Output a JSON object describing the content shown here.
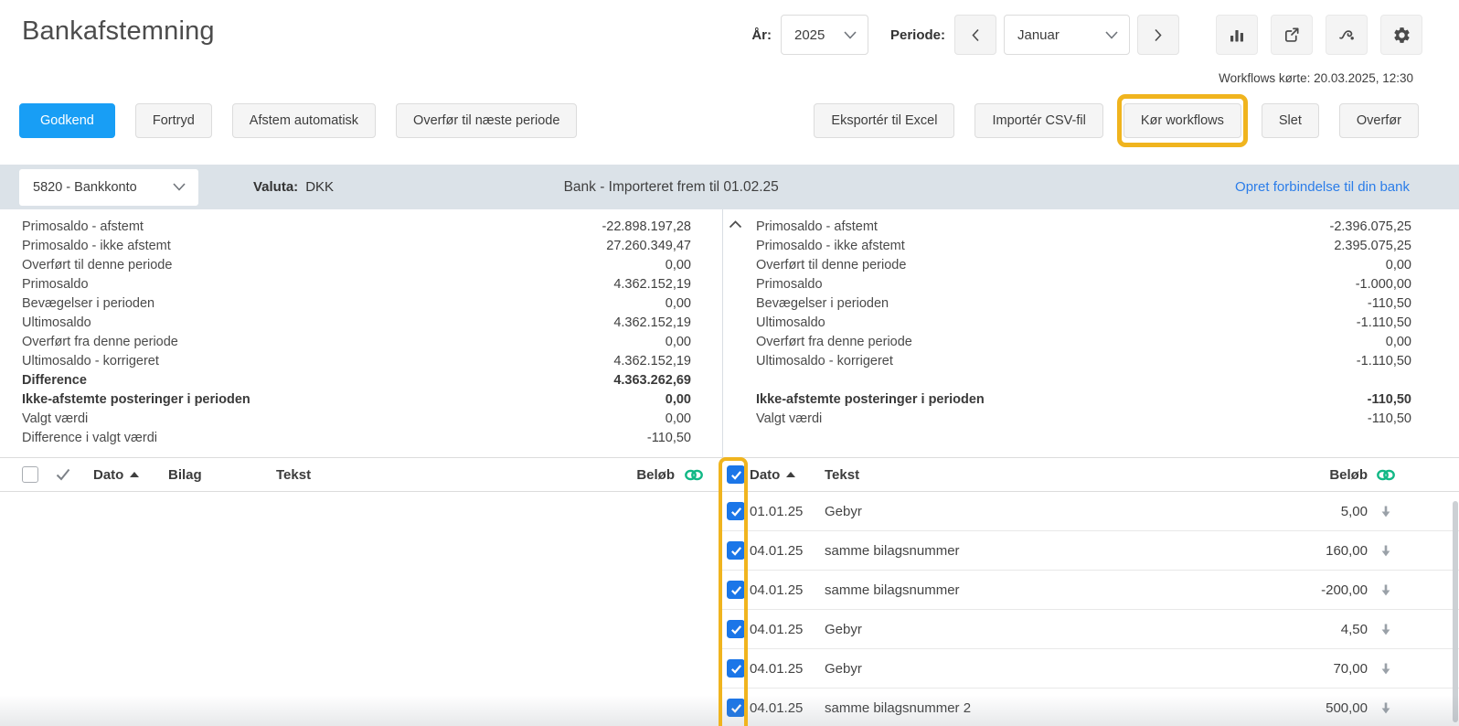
{
  "app": {
    "title": "Bankafstemning"
  },
  "period_bar": {
    "year_label": "År:",
    "year_value": "2025",
    "period_label": "Periode:",
    "period_value": "Januar",
    "icons": [
      "bar-chart",
      "open-external",
      "workflow",
      "settings"
    ],
    "workflows_last_run": "Workflows kørte: 20.03.2025, 12:30"
  },
  "actions": {
    "approve": "Godkend",
    "undo": "Fortryd",
    "auto_reconcile": "Afstem automatisk",
    "transfer_next_period": "Overfør til næste periode",
    "export_excel": "Eksportér til Excel",
    "import_csv": "Importér CSV-fil",
    "run_workflows": "Kør workflows",
    "delete": "Slet",
    "transfer": "Overfør"
  },
  "account_bar": {
    "account": "5820 - Bankkonto",
    "currency_label": "Valuta:",
    "currency": "DKK",
    "bank_status": "Bank - Importeret frem til 01.02.25",
    "connect_link": "Opret forbindelse til din bank"
  },
  "summary_left": {
    "rows": [
      {
        "label": "Primosaldo - afstemt",
        "value": "-22.898.197,28"
      },
      {
        "label": "Primosaldo - ikke afstemt",
        "value": "27.260.349,47"
      },
      {
        "label": "Overført til denne periode",
        "value": "0,00"
      },
      {
        "label": "Primosaldo",
        "value": "4.362.152,19"
      },
      {
        "label": "Bevægelser i perioden",
        "value": "0,00"
      },
      {
        "label": "Ultimosaldo",
        "value": "4.362.152,19"
      },
      {
        "label": "Overført fra denne periode",
        "value": "0,00"
      },
      {
        "label": "Ultimosaldo - korrigeret",
        "value": "4.362.152,19"
      },
      {
        "label": "Difference",
        "value": "4.363.262,69"
      },
      {
        "label": "Ikke-afstemte posteringer i perioden",
        "value": "0,00"
      },
      {
        "label": "Valgt værdi",
        "value": "0,00"
      },
      {
        "label": "Difference i valgt værdi",
        "value": "-110,50"
      }
    ]
  },
  "summary_right": {
    "rows": [
      {
        "label": "Primosaldo - afstemt",
        "value": "-2.396.075,25"
      },
      {
        "label": "Primosaldo - ikke afstemt",
        "value": "2.395.075,25"
      },
      {
        "label": "Overført til denne periode",
        "value": "0,00"
      },
      {
        "label": "Primosaldo",
        "value": "-1.000,00"
      },
      {
        "label": "Bevægelser i perioden",
        "value": "-110,50"
      },
      {
        "label": "Ultimosaldo",
        "value": "-1.110,50"
      },
      {
        "label": "Overført fra denne periode",
        "value": "0,00"
      },
      {
        "label": "Ultimosaldo - korrigeret",
        "value": "-1.110,50"
      },
      {
        "label": "",
        "value": ""
      },
      {
        "label": "Ikke-afstemte posteringer i perioden",
        "value": "-110,50"
      },
      {
        "label": "Valgt værdi",
        "value": "-110,50"
      }
    ]
  },
  "ledger_table": {
    "headers": {
      "dato": "Dato",
      "bilag": "Bilag",
      "tekst": "Tekst",
      "belob": "Beløb"
    }
  },
  "bank_table": {
    "headers": {
      "dato": "Dato",
      "tekst": "Tekst",
      "belob": "Beløb"
    },
    "rows": [
      {
        "date": "01.01.25",
        "text": "Gebyr",
        "amount": "5,00"
      },
      {
        "date": "04.01.25",
        "text": "samme bilagsnummer",
        "amount": "160,00"
      },
      {
        "date": "04.01.25",
        "text": "samme bilagsnummer",
        "amount": "-200,00"
      },
      {
        "date": "04.01.25",
        "text": "Gebyr",
        "amount": "4,50"
      },
      {
        "date": "04.01.25",
        "text": "Gebyr",
        "amount": "70,00"
      },
      {
        "date": "04.01.25",
        "text": "samme bilagsnummer 2",
        "amount": "500,00"
      }
    ]
  },
  "colors": {
    "primary_blue": "#189ef5",
    "highlight_orange": "#f0b41e",
    "link_green": "#12b886",
    "link_blue": "#2b7de9",
    "checkbox_blue": "#1b76e8",
    "account_bar_bg": "#dbe2e8"
  }
}
